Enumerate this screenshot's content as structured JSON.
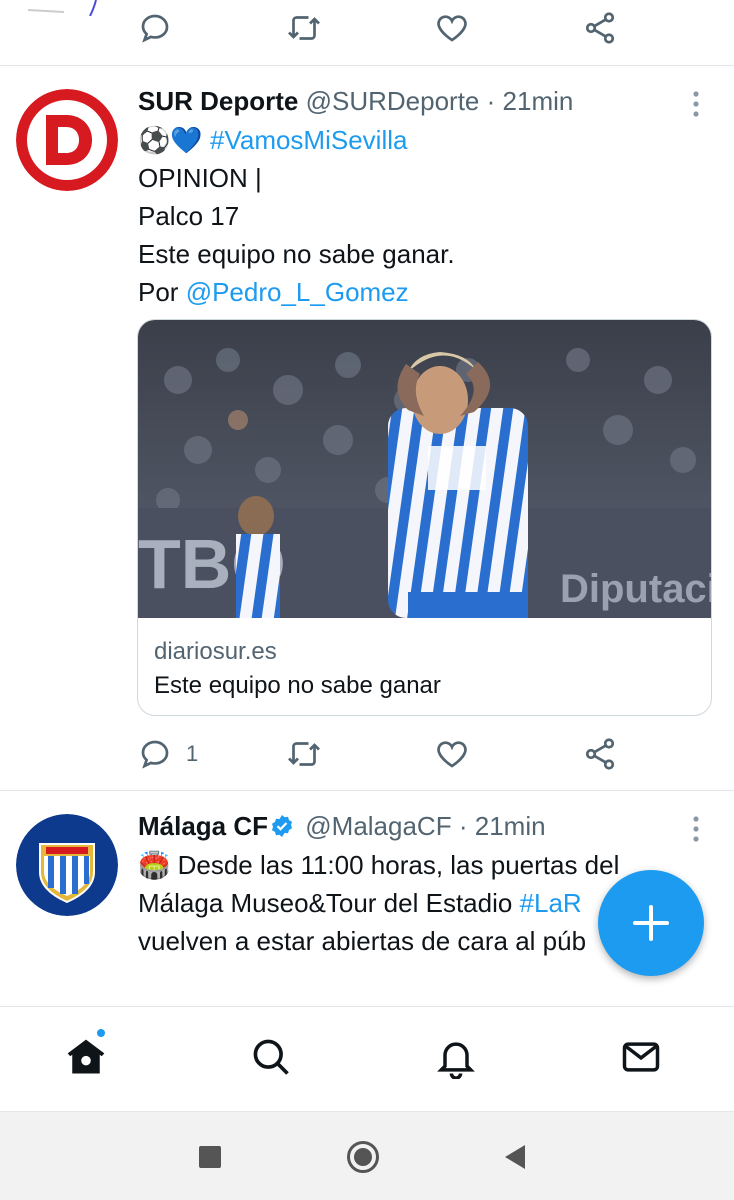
{
  "prev_tweet": {
    "actions": {
      "reply_icon": "reply-icon",
      "retweet_icon": "retweet-icon",
      "like_icon": "like-icon",
      "share_icon": "share-icon"
    }
  },
  "tweets": [
    {
      "name": "SUR Deporte",
      "handle": "@SURDeporte",
      "separator": "·",
      "time": "21min",
      "avatar_letter": "D",
      "lines": {
        "emoji": "⚽💙",
        "hashtag": "#VamosMiSevilla",
        "line2": "OPINION |",
        "line3": "Palco 17",
        "line4": "Este equipo no sabe ganar.",
        "line5_prefix": "Por ",
        "line5_mention": "@Pedro_L_Gomez"
      },
      "card": {
        "domain": "diariosur.es",
        "title": "Este equipo no sabe ganar",
        "image_sign_text": "Diputació",
        "image_board_text": "TBO"
      },
      "actions": {
        "reply_count": "1"
      }
    },
    {
      "name": "Málaga CF",
      "handle": "@MalagaCF",
      "separator": "·",
      "time": "21min",
      "verified": true,
      "lines": {
        "emoji": "🏟️",
        "line1": " Desde las 11:00 horas, las puertas del",
        "line2_prefix": "Málaga Museo&Tour del Estadio ",
        "line2_hashtag": "#LaR",
        "line3": "vuelven a estar abiertas de cara al púb"
      }
    }
  ],
  "nav": {
    "items": [
      "home-icon",
      "search-icon",
      "notifications-icon",
      "messages-icon"
    ],
    "home_has_new": true
  },
  "fab": {
    "icon": "plus-icon"
  },
  "system_nav": [
    "recent-apps-icon",
    "home-circle-icon",
    "back-icon"
  ],
  "colors": {
    "accent": "#1d9bf0",
    "text": "#0f1419",
    "muted": "#536471",
    "divider": "#e3e6e8"
  }
}
